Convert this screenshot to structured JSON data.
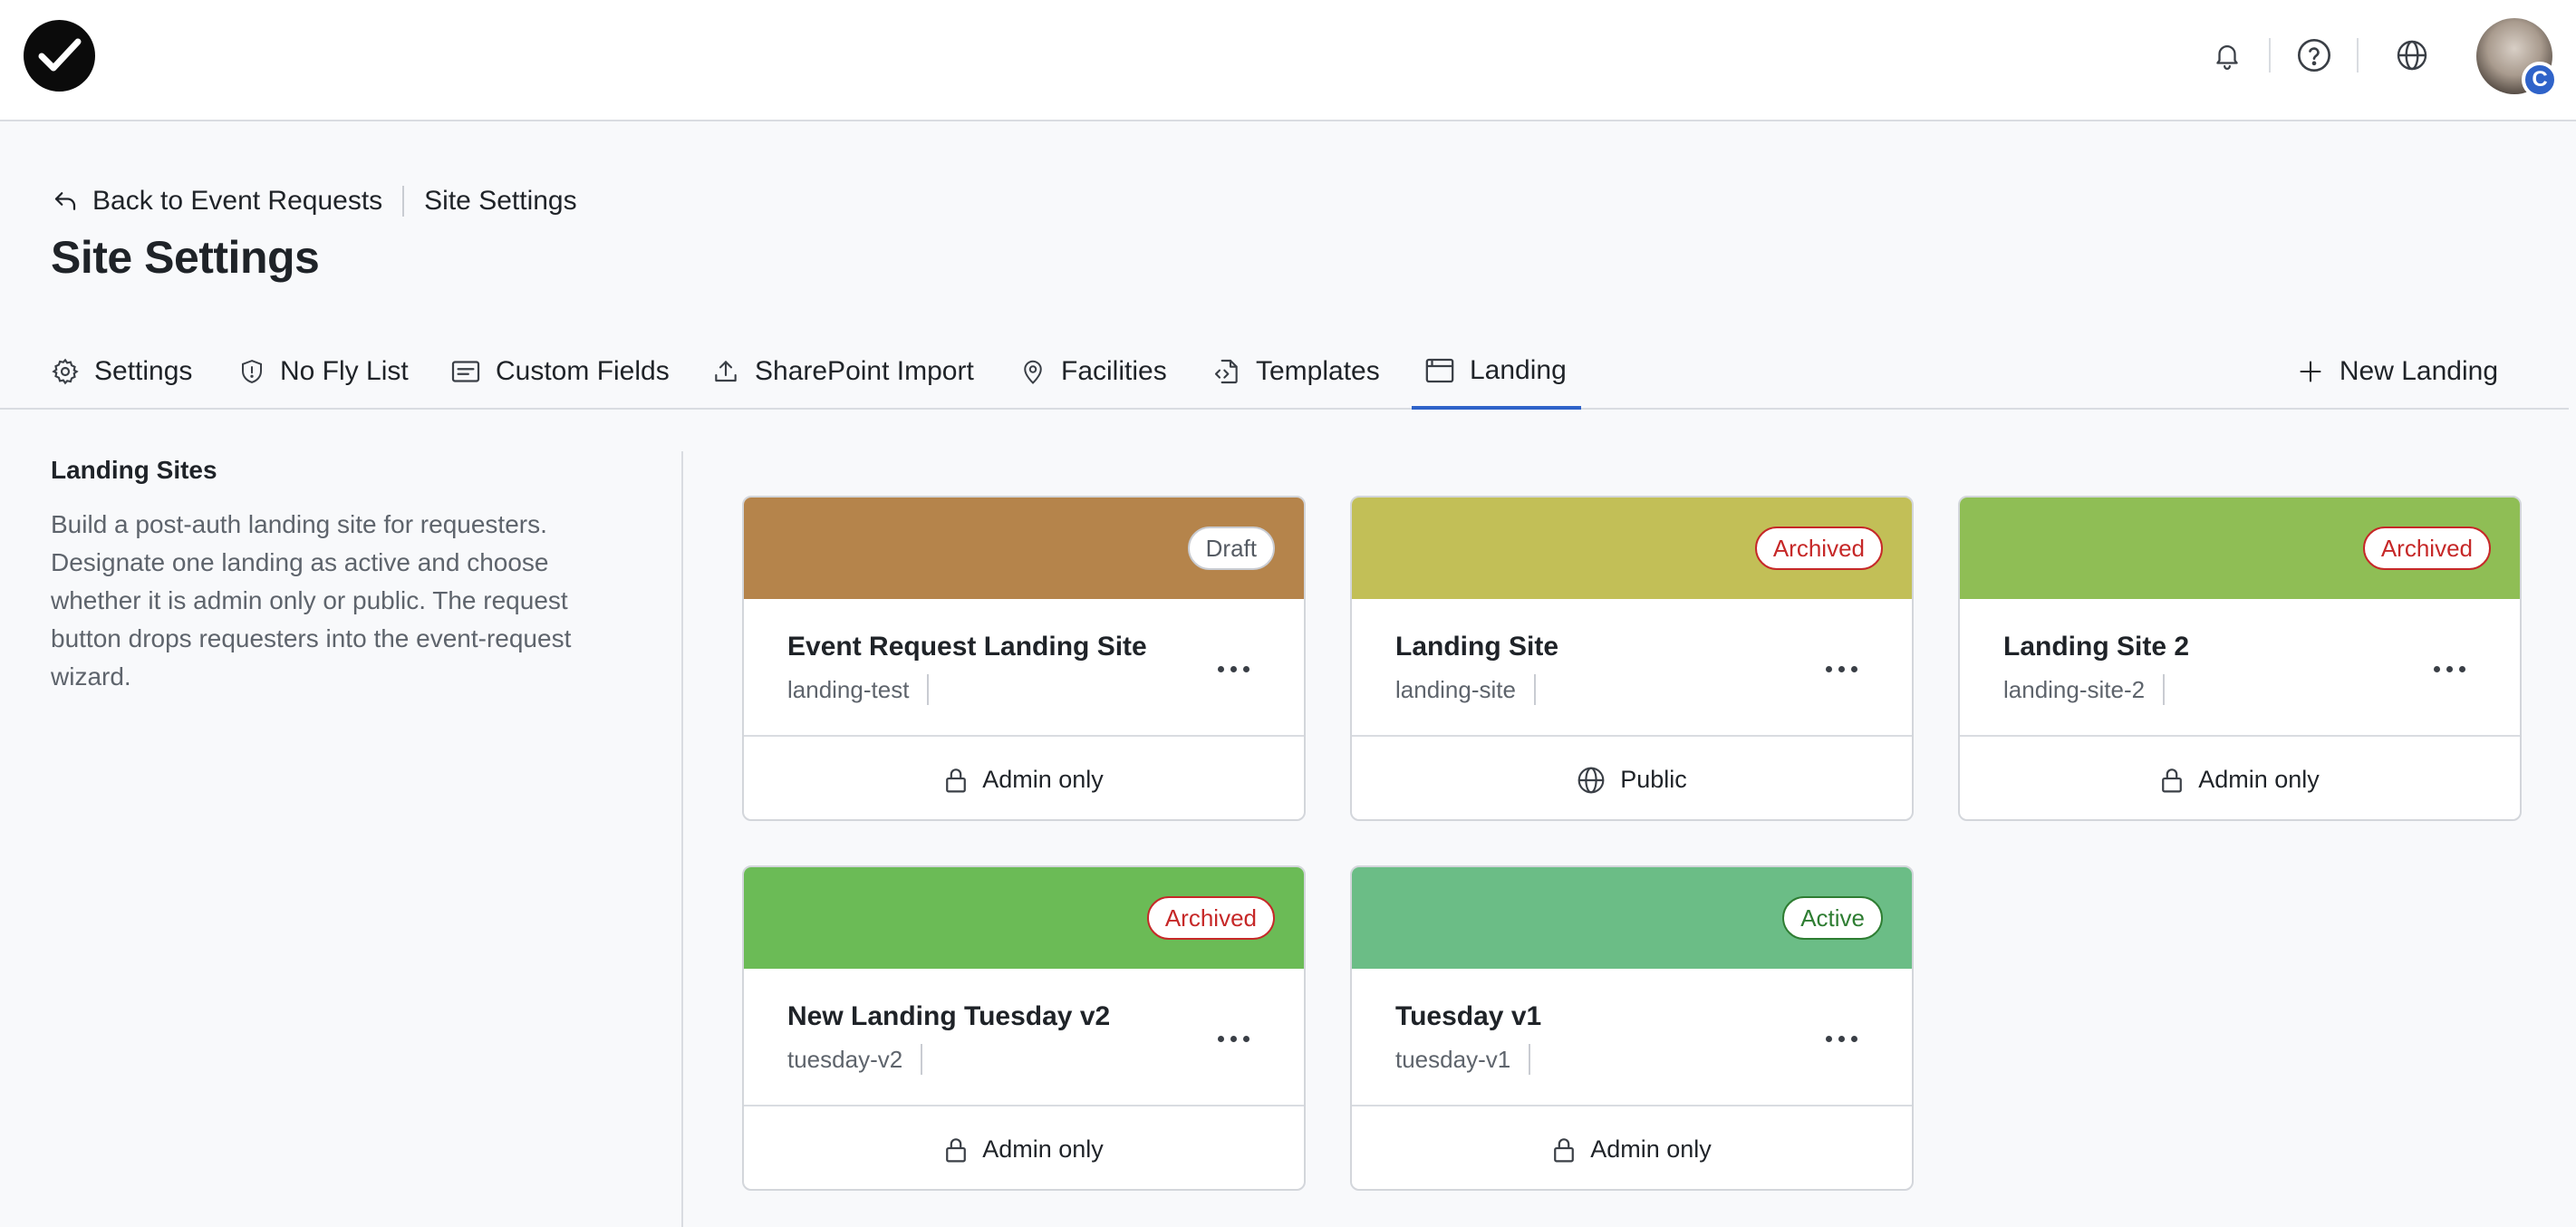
{
  "header": {
    "logo_alt": "app logo",
    "icons": [
      "bell-icon",
      "help-icon",
      "globe-icon"
    ],
    "avatar_badge": "C"
  },
  "breadcrumb": {
    "back_label": "Back to Event Requests",
    "current": "Site Settings"
  },
  "page_title": "Site Settings",
  "tabs": [
    {
      "label": "Settings",
      "icon": "gear-icon"
    },
    {
      "label": "No Fly List",
      "icon": "shield-icon"
    },
    {
      "label": "Custom Fields",
      "icon": "form-icon"
    },
    {
      "label": "SharePoint Import",
      "icon": "upload-icon"
    },
    {
      "label": "Facilities",
      "icon": "location-pin-icon"
    },
    {
      "label": "Templates",
      "icon": "file-code-icon"
    },
    {
      "label": "Landing",
      "icon": "browser-window-icon",
      "active": true
    }
  ],
  "new_landing_label": "New Landing",
  "sidebar": {
    "title": "Landing Sites",
    "description": "Build a post-auth landing site for requesters. Designate one landing as active and choose whether it is admin only or public. The request button drops requesters into the event-request wizard."
  },
  "cards": [
    {
      "name": "Event Request Landing Site",
      "slug": "landing-test",
      "status": "Draft",
      "status_kind": "draft",
      "banner_color": "#b5844b",
      "access": "Admin only",
      "access_icon": "lock-icon"
    },
    {
      "name": "Landing Site",
      "slug": "landing-site",
      "status": "Archived",
      "status_kind": "archived",
      "banner_color": "#c2bf57",
      "access": "Public",
      "access_icon": "globe-icon"
    },
    {
      "name": "Landing Site 2",
      "slug": "landing-site-2",
      "status": "Archived",
      "status_kind": "archived",
      "banner_color": "#8fbe55",
      "access": "Admin only",
      "access_icon": "lock-icon"
    },
    {
      "name": "New Landing Tuesday v2",
      "slug": "tuesday-v2",
      "status": "Archived",
      "status_kind": "archived",
      "banner_color": "#6bbb56",
      "access": "Admin only",
      "access_icon": "lock-icon"
    },
    {
      "name": "Tuesday v1",
      "slug": "tuesday-v1",
      "status": "Active",
      "status_kind": "active",
      "banner_color": "#6bbd86",
      "access": "Admin only",
      "access_icon": "lock-icon"
    }
  ],
  "colors": {
    "accent": "#2f63c9",
    "archived": "#c62828",
    "active": "#2e7d32"
  }
}
